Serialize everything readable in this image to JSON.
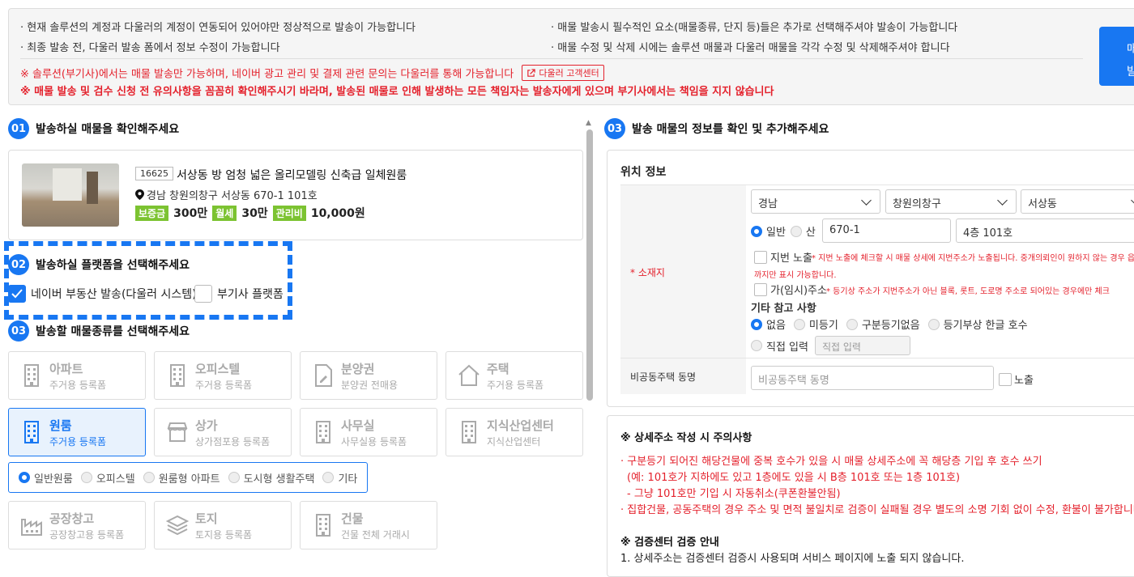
{
  "notice": {
    "line1": "· 현재 솔루션의 계정과 다울러의 계정이 연동되어 있어야만 정상적으로 발송이 가능합니다",
    "line2": "· 최종 발송 전, 다울러 발송 폼에서 정보 수정이 가능합니다",
    "line3": "· 매물 발송시 필수적인 요소(매물종류, 단지 등)들은 추가로 선택해주셔야 발송이 가능합니다",
    "line4": "· 매물 수정 및 삭제 시에는 솔루션 매물과 다울러 매물을 각각 수정 및 삭제해주셔야 합니다",
    "warn1": "※ 솔루션(부기사)에서는 매물 발송만 가능하며, 네이버 광고 관리 및 결제 관련 문의는 다울러를 통해 가능합니다",
    "link": "다울러 고객센터",
    "warn2": "※ 매물 발송 및 검수 신청 전 유의사항을 꼼꼼히 확인해주시기 바라며, 발송된 매물로 인해 발생하는 모든 책임자는 발송자에게 있으며 부기사에서는 책임을 지지 않습니다",
    "send_button": "매\n발"
  },
  "sections": {
    "s1": {
      "num": "01",
      "title": "발송하실 매물을 확인해주세요"
    },
    "s2": {
      "num": "02",
      "title": "발송하실 플랫폼을 선택해주세요"
    },
    "s3": {
      "num": "03",
      "title": "발송할 매물종류를 선택해주세요"
    },
    "s4": {
      "num": "03",
      "title": "발송 매물의 정보를 확인 및 추가해주세요"
    }
  },
  "property": {
    "id": "16625",
    "title": "서상동 방 엄청 넓은 올리모델링 신축급 일체원룸",
    "address": "경남 창원의창구 서상동 670-1 101호",
    "deposit_tag": "보증금",
    "deposit": "300만",
    "rent_tag": "월세",
    "rent": "30만",
    "fee_tag": "관리비",
    "fee": "10,000원"
  },
  "platforms": [
    {
      "label": "네이버 부동산 발송(다울러 시스템)",
      "checked": true
    },
    {
      "label": "부기사 플랫폼",
      "checked": false
    }
  ],
  "types": [
    {
      "name": "아파트",
      "sub": "주거용 등록폼",
      "icon": "building-icon"
    },
    {
      "name": "오피스텔",
      "sub": "주거용 등록폼",
      "icon": "building-icon"
    },
    {
      "name": "분양권",
      "sub": "분양권 전매용",
      "icon": "document-edit-icon"
    },
    {
      "name": "주택",
      "sub": "주거용 등록폼",
      "icon": "house-icon"
    },
    {
      "name": "원룸",
      "sub": "주거용 등록폼",
      "icon": "building-icon",
      "selected": true
    },
    {
      "name": "상가",
      "sub": "상가점포용 등록폼",
      "icon": "store-icon"
    },
    {
      "name": "사무실",
      "sub": "사무실용 등록폼",
      "icon": "building-icon"
    },
    {
      "name": "지식산업센터",
      "sub": "지식산업센터",
      "icon": "building-icon"
    },
    {
      "name": "공장창고",
      "sub": "공장창고용 등록폼",
      "icon": "factory-icon"
    },
    {
      "name": "토지",
      "sub": "토지용 등록폼",
      "icon": "layers-icon"
    },
    {
      "name": "건물",
      "sub": "건물 전체 거래시",
      "icon": "building-icon"
    }
  ],
  "subtypes": [
    "일반원룸",
    "오피스텔",
    "원룸형 아파트",
    "도시형 생활주택",
    "기타"
  ],
  "location": {
    "heading": "위치 정보",
    "label": "* 소재지",
    "sido": "경남",
    "sigungu": "창원의창구",
    "dong": "서상동",
    "addr_type_general": "일반",
    "addr_type_mountain": "산",
    "lot": "670-1",
    "unit": "4층 101호",
    "lot_expose_label": "지번 노출",
    "lot_expose_note": "* 지번 노출에 체크할 시 매물 상세에 지번주소가 노출됩니다. 중개의뢰인이 원하지 않는 경우 읍·면·동",
    "lot_expose_note2": "까지만 표시 가능합니다.",
    "temp_addr_label": "가(임시)주소",
    "temp_addr_note": "* 등기상 주소가 지번주소가 아닌 블록, 롯트, 도로명 주소로 되어있는 경우에만 체크",
    "etc_heading": "기타 참고 사항",
    "etc_options": [
      "없음",
      "미등기",
      "구분등기없음",
      "등기부상 한글 호수"
    ],
    "direct_input": "직접 입력",
    "direct_placeholder": "직접 입력",
    "nonapt_label": "비공동주택 동명",
    "nonapt_placeholder": "비공동주택 동명",
    "expose": "노출"
  },
  "caution": {
    "title1": "※ 상세주소 작성 시 주의사항",
    "r1": "· 구분등기 되어진 해당건물에 중복 호수가 있을 시 매물 상세주소에 꼭 해당층 기입 후 호수 쓰기",
    "r2": "(예: 101호가 지하에도 있고 1층에도 있을 시 B층 101호 또는 1층 101호)",
    "r3": "- 그냥 101호만 기입 시 자동취소(쿠폰환불안됨)",
    "r4": "· 집합건물, 공동주택의 경우 주소 및 면적 불일치로 검증이 실패될 경우 별도의 소명 기회 없이 수정, 환불이 불가합니다.",
    "title2": "※ 검증센터 검증 안내",
    "b1": "1. 상세주소는 검증센터 검증시 사용되며 서비스 페이지에 노출 되지 않습니다."
  },
  "colors": {
    "accent": "#1877f2",
    "warning": "#e4212c",
    "tag": "#7cc331"
  }
}
